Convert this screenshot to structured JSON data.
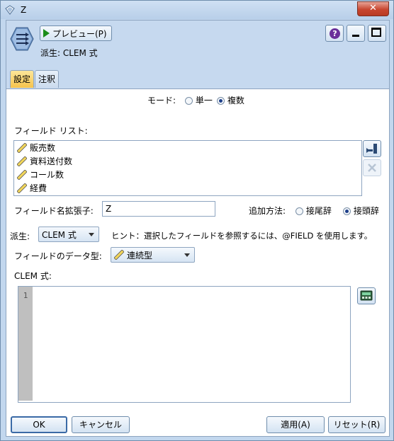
{
  "window": {
    "title": "Z",
    "close_symbol": "✕"
  },
  "header": {
    "preview_label": "プレビュー(P)",
    "derive_text": "派生: CLEM 式",
    "help_symbol": "?"
  },
  "tabs": [
    {
      "label": "設定"
    },
    {
      "label": "注釈"
    }
  ],
  "mode": {
    "label": "モード:",
    "options": [
      {
        "label": "単一",
        "selected": false
      },
      {
        "label": "複数",
        "selected": true
      }
    ]
  },
  "field_list": {
    "label": "フィールド リスト:",
    "items": [
      "販売数",
      "資料送付数",
      "コール数",
      "経費"
    ]
  },
  "extension": {
    "label": "フィールド名拡張子:",
    "value": "Z",
    "add_method_label": "追加方法:",
    "options": [
      {
        "label": "接尾辞",
        "selected": false
      },
      {
        "label": "接頭辞",
        "selected": true
      }
    ]
  },
  "derive": {
    "label": "派生:",
    "selected": "CLEM 式",
    "hint": "ヒント：選択したフィールドを参照するには、@FIELD を使用します。"
  },
  "datatype": {
    "label": "フィールドのデータ型:",
    "selected": "連続型"
  },
  "clem": {
    "label": "CLEM 式:",
    "line_number": "1",
    "value": ""
  },
  "footer": {
    "ok": "OK",
    "cancel": "キャンセル",
    "apply": "適用(A)",
    "reset": "リセット(R)"
  },
  "colors": {
    "accent_tab": "#f6c34c",
    "header_bg": "#c6d9ef",
    "close_red": "#c8462f"
  }
}
